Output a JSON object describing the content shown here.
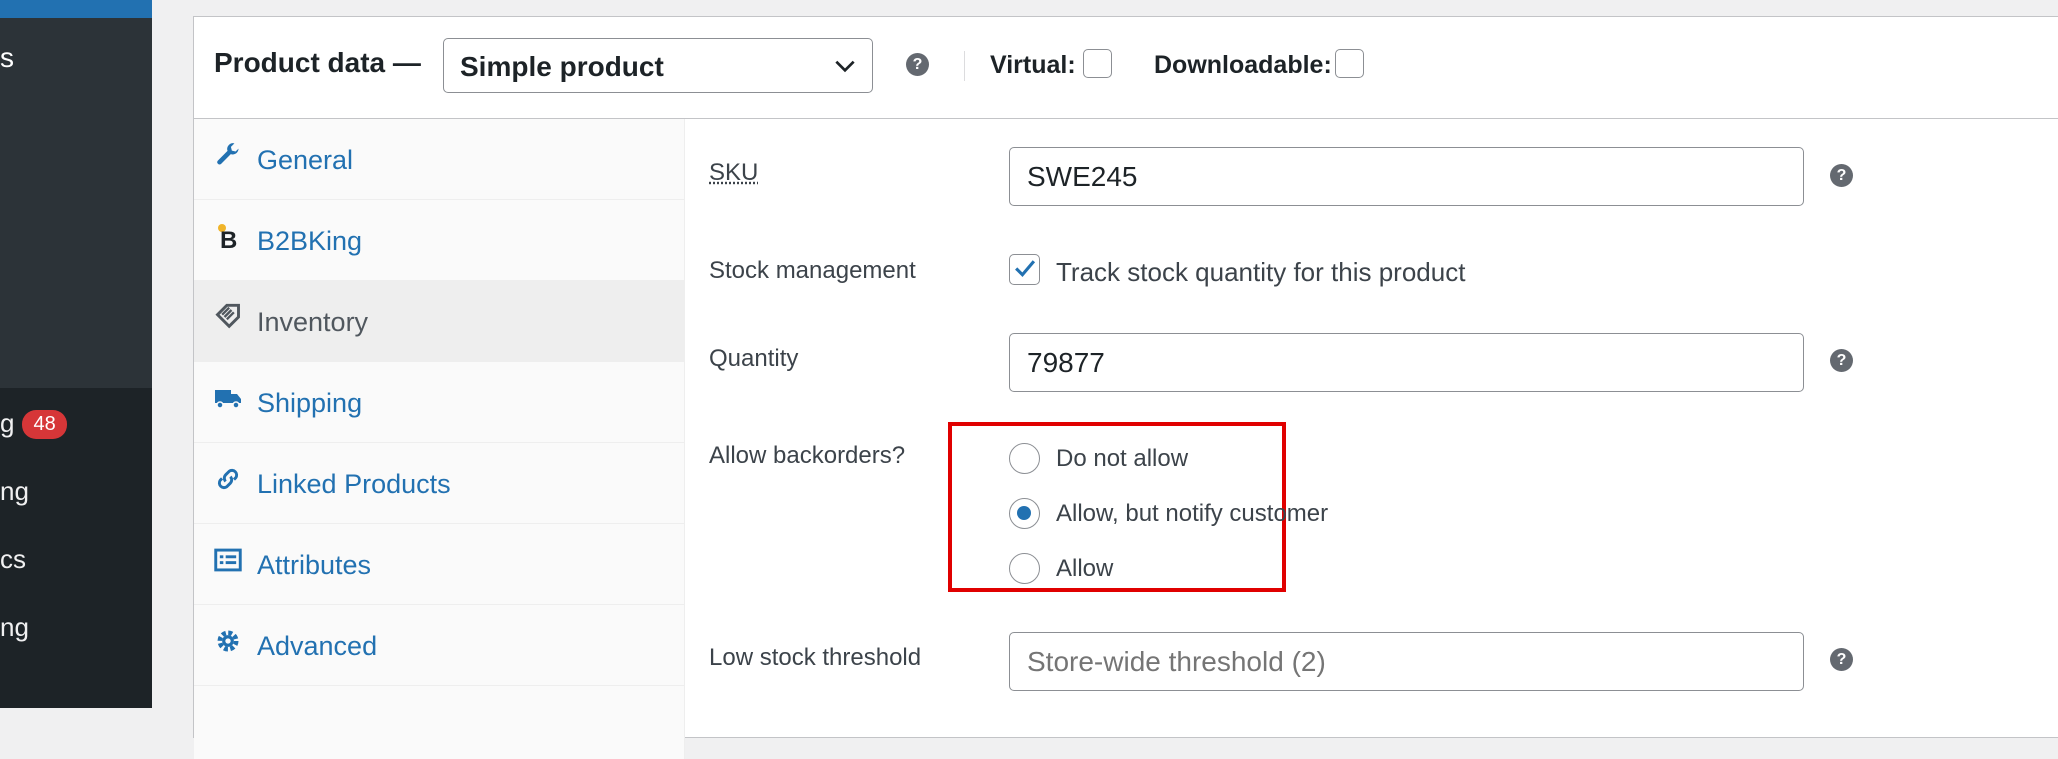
{
  "sidebar": {
    "top_item_fragment": "s",
    "menu_fragments": [
      {
        "text": "g",
        "badge": "48"
      },
      {
        "text": "ng",
        "badge": null
      },
      {
        "text": "cs",
        "badge": null
      },
      {
        "text": "ng",
        "badge": null
      }
    ]
  },
  "header": {
    "title": "Product data —",
    "product_type": "Simple product",
    "help": "?",
    "virtual_label": "Virtual:",
    "downloadable_label": "Downloadable:",
    "virtual_checked": false,
    "downloadable_checked": false
  },
  "tabs": [
    {
      "label": "General",
      "icon": "wrench-icon",
      "active": false
    },
    {
      "label": "B2BKing",
      "icon": "b2bking-logo-icon",
      "active": false
    },
    {
      "label": "Inventory",
      "icon": "tag-icon",
      "active": true
    },
    {
      "label": "Shipping",
      "icon": "truck-icon",
      "active": false
    },
    {
      "label": "Linked Products",
      "icon": "link-icon",
      "active": false
    },
    {
      "label": "Attributes",
      "icon": "list-icon",
      "active": false
    },
    {
      "label": "Advanced",
      "icon": "gear-icon",
      "active": false
    }
  ],
  "inventory": {
    "sku_label": "SKU",
    "sku_value": "SWE245",
    "stock_management_label": "Stock management",
    "track_stock_label": "Track stock quantity for this product",
    "track_stock_checked": true,
    "quantity_label": "Quantity",
    "quantity_value": "79877",
    "backorders_label": "Allow backorders?",
    "backorder_options": [
      {
        "label": "Do not allow",
        "selected": false
      },
      {
        "label": "Allow, but notify customer",
        "selected": true
      },
      {
        "label": "Allow",
        "selected": false
      }
    ],
    "low_stock_label": "Low stock threshold",
    "low_stock_placeholder": "Store-wide threshold (2)"
  },
  "colors": {
    "link": "#2271b1",
    "highlight": "#e00000",
    "badge": "#d63638"
  }
}
